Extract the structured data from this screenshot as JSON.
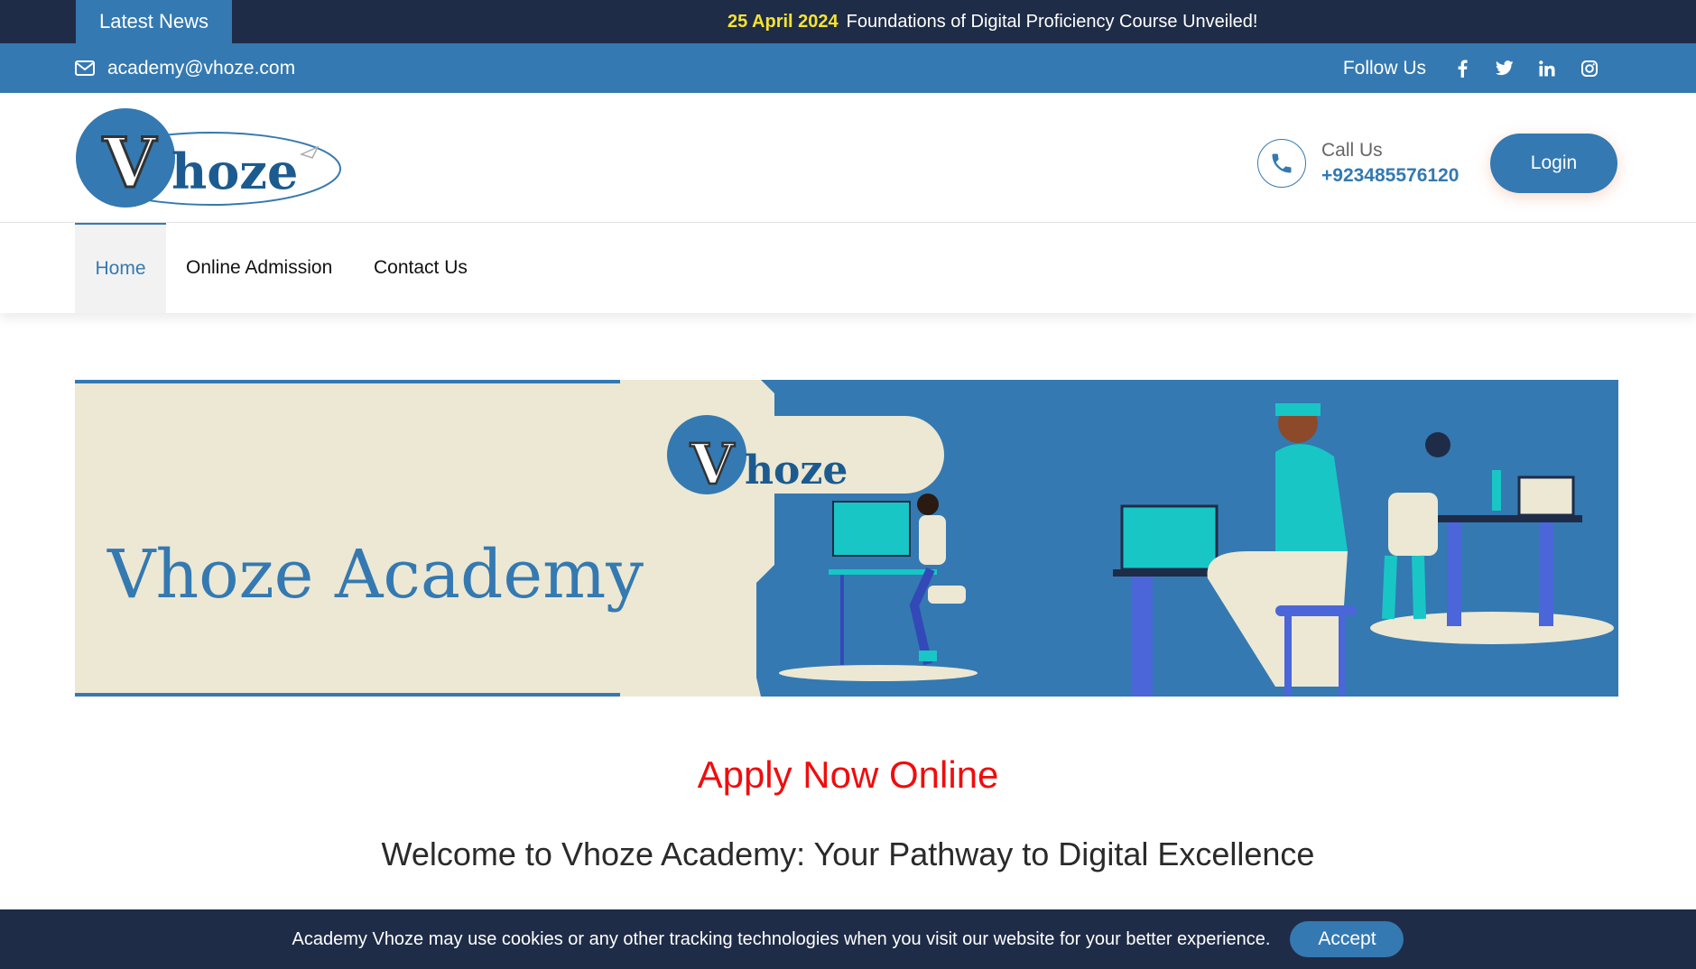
{
  "ticker": {
    "label": "Latest News",
    "date": "25 April 2024",
    "headline": "Foundations of Digital Proficiency Course Unveiled!"
  },
  "topbar": {
    "email": "academy@vhoze.com",
    "follow_label": "Follow Us",
    "socials": [
      "facebook-icon",
      "twitter-icon",
      "linkedin-icon",
      "instagram-icon"
    ]
  },
  "header": {
    "logo_text": "Vhoze",
    "call_label": "Call Us",
    "call_number": "+923485576120",
    "login_label": "Login"
  },
  "nav": {
    "items": [
      {
        "label": "Home",
        "active": true
      },
      {
        "label": "Online Admission",
        "active": false
      },
      {
        "label": "Contact Us",
        "active": false
      }
    ]
  },
  "banner": {
    "logo_text": "Vhoze",
    "title": "Vhoze Academy"
  },
  "content": {
    "apply_heading": "Apply Now Online",
    "welcome_heading": "Welcome to Vhoze Academy: Your Pathway to Digital Excellence"
  },
  "cookie": {
    "text": "Academy Vhoze may use cookies or any other tracking technologies when you visit our website for your better experience.",
    "accept_label": "Accept"
  },
  "colors": {
    "primary": "#3479b1",
    "dark": "#1f2c47",
    "highlight": "#f5e332",
    "apply_red": "#f00d0d",
    "banner_cream": "#ece8d4"
  }
}
